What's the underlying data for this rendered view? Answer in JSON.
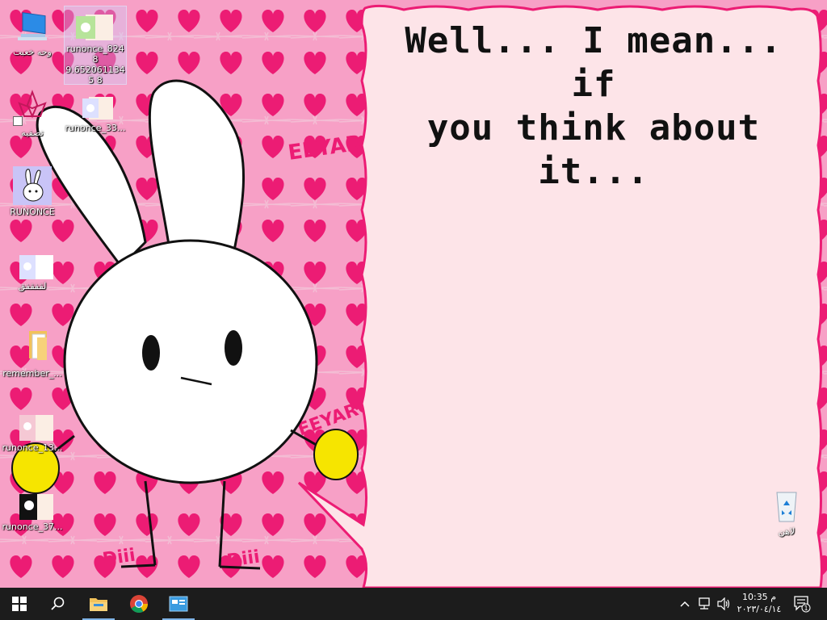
{
  "bubble": {
    "line1": "Well... I mean... if",
    "line2": "you think about it..."
  },
  "wallpaper_text": {
    "logo_top": "EEYARO",
    "logo_mid": "EEYARO",
    "logo_bottom_a": "Diii",
    "logo_bottom_b": "Diii"
  },
  "desktop_icons": [
    {
      "label": "وحه خعبت",
      "icon": "monitor-icon"
    },
    {
      "label": "runonce_8248 9.6520611345 8",
      "icon": "image-thumb-icon"
    },
    {
      "label": "تصفيه",
      "icon": "lotus-icon"
    },
    {
      "label": "runonce_33...",
      "icon": "image-thumb-icon"
    },
    {
      "label": "RUNONCE",
      "icon": "bunny-icon"
    },
    {
      "label": "لقفقفق",
      "icon": "image-thumb-icon"
    },
    {
      "label": "remember_...",
      "icon": "folder-icon"
    },
    {
      "label": "runonce_13...",
      "icon": "image-thumb-icon"
    },
    {
      "label": "runonce_37...",
      "icon": "image-thumb-icon"
    },
    {
      "label": "لاهن",
      "icon": "recycle-bin-icon"
    }
  ],
  "taskbar": {
    "time": "10:35 م",
    "date": "٢٠٢٣/٠٤/١٤",
    "notification_count": "1"
  },
  "colors": {
    "wallpaper_pink": "#f7a0c6",
    "heart": "#ec1c74",
    "bubble": "#fde4e8",
    "taskbar": "#1c1c1c"
  }
}
